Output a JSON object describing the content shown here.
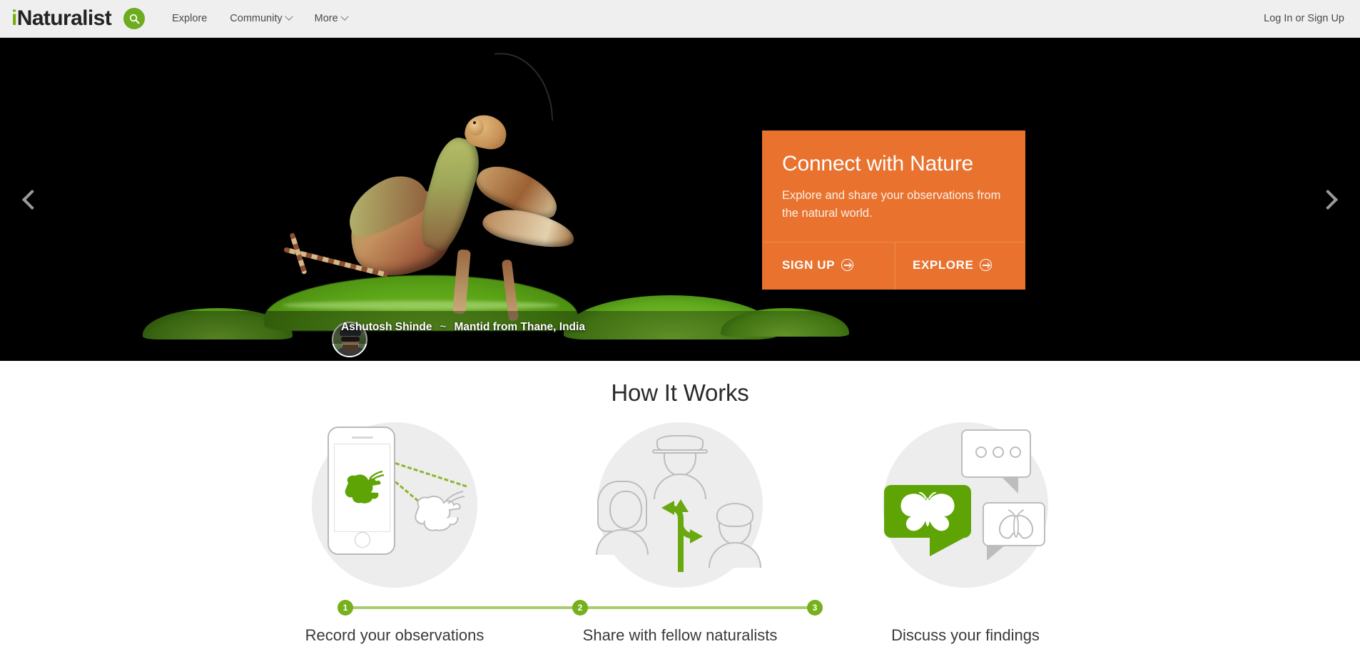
{
  "header": {
    "logo_i": "i",
    "logo_rest": "Naturalist",
    "search_icon": "search-icon",
    "nav": [
      {
        "label": "Explore",
        "has_caret": false
      },
      {
        "label": "Community",
        "has_caret": true
      },
      {
        "label": "More",
        "has_caret": true
      }
    ],
    "auth": {
      "login": "Log In",
      "or": " or ",
      "signup": "Sign Up"
    }
  },
  "hero": {
    "prev_icon": "chevron-left-icon",
    "next_icon": "chevron-right-icon",
    "promo": {
      "title": "Connect with Nature",
      "subtitle": "Explore and share your observations from the natural world.",
      "signup_label": "SIGN UP",
      "explore_label": "EXPLORE",
      "background_color": "#e8722e"
    },
    "credit": {
      "author": "Ashutosh Shinde",
      "separator": "~",
      "caption": "Mantid from Thane, India",
      "avatar": "user-avatar"
    }
  },
  "how_it_works": {
    "title": "How It Works",
    "steps": [
      {
        "number": "1",
        "caption": "Record your observations",
        "icon": "phone-camera-caterpillar-icon"
      },
      {
        "number": "2",
        "caption": "Share with fellow naturalists",
        "icon": "three-people-share-icon"
      },
      {
        "number": "3",
        "caption": "Discuss your findings",
        "icon": "speech-bubbles-butterfly-moth-icon"
      }
    ]
  },
  "colors": {
    "brand_green": "#74ac00",
    "accent_orange": "#e8722e",
    "step_green": "#76b01c",
    "header_bg": "#efefef"
  }
}
